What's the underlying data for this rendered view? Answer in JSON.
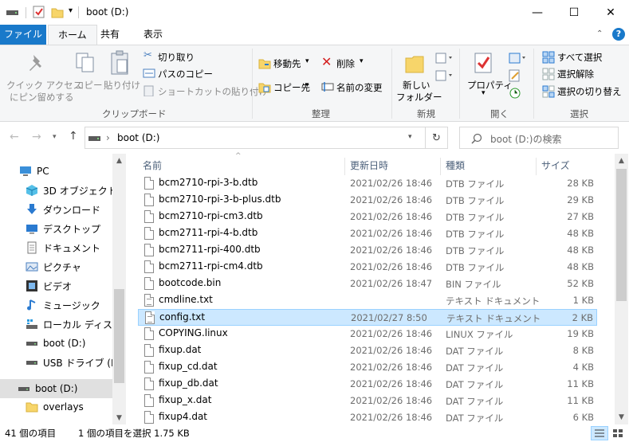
{
  "window": {
    "title": "boot (D:)",
    "minimize": "—",
    "maximize": "☐",
    "close": "✕"
  },
  "ribbon_tabs": {
    "file": "ファイル",
    "home": "ホーム",
    "share": "共有",
    "view": "表示"
  },
  "ribbon": {
    "clipboard": {
      "pin_quick_access": [
        "クイック アクセス",
        "にピン留めする"
      ],
      "copy": "コピー",
      "paste": "貼り付け",
      "cut": "切り取り",
      "copy_path": "パスのコピー",
      "paste_shortcut": "ショートカットの貼り付け",
      "group_label": "クリップボード"
    },
    "organize": {
      "move_to": "移動先",
      "copy_to": "コピー先",
      "delete": "削除",
      "rename": "名前の変更",
      "group_label": "整理"
    },
    "new": {
      "new_folder": [
        "新しい",
        "フォルダー"
      ],
      "group_label": "新規"
    },
    "open": {
      "properties": "プロパティ",
      "group_label": "開く"
    },
    "select": {
      "select_all": "すべて選択",
      "select_none": "選択解除",
      "invert": "選択の切り替え",
      "group_label": "選択"
    }
  },
  "navbar": {
    "path_separator": "›",
    "path_current": "boot (D:)",
    "search_placeholder": "boot (D:)の検索"
  },
  "nav_pane": [
    {
      "label": "PC"
    },
    {
      "label": "3D オブジェクト"
    },
    {
      "label": "ダウンロード"
    },
    {
      "label": "デスクトップ"
    },
    {
      "label": "ドキュメント"
    },
    {
      "label": "ピクチャ"
    },
    {
      "label": "ビデオ"
    },
    {
      "label": "ミュージック"
    },
    {
      "label": "ローカル ディスク (C"
    },
    {
      "label": "boot (D:)"
    },
    {
      "label": "USB ドライブ (E:)"
    },
    {
      "label": "boot (D:)"
    },
    {
      "label": "overlays"
    }
  ],
  "columns": {
    "name": "名前",
    "date": "更新日時",
    "type": "種類",
    "size": "サイズ"
  },
  "files": [
    {
      "name": "bcm2710-rpi-3-b.dtb",
      "date": "2021/02/26 18:46",
      "type": "DTB ファイル",
      "size": "28 KB"
    },
    {
      "name": "bcm2710-rpi-3-b-plus.dtb",
      "date": "2021/02/26 18:46",
      "type": "DTB ファイル",
      "size": "29 KB"
    },
    {
      "name": "bcm2710-rpi-cm3.dtb",
      "date": "2021/02/26 18:46",
      "type": "DTB ファイル",
      "size": "27 KB"
    },
    {
      "name": "bcm2711-rpi-4-b.dtb",
      "date": "2021/02/26 18:46",
      "type": "DTB ファイル",
      "size": "48 KB"
    },
    {
      "name": "bcm2711-rpi-400.dtb",
      "date": "2021/02/26 18:46",
      "type": "DTB ファイル",
      "size": "48 KB"
    },
    {
      "name": "bcm2711-rpi-cm4.dtb",
      "date": "2021/02/26 18:46",
      "type": "DTB ファイル",
      "size": "48 KB"
    },
    {
      "name": "bootcode.bin",
      "date": "2021/02/26 18:47",
      "type": "BIN ファイル",
      "size": "52 KB"
    },
    {
      "name": "cmdline.txt",
      "date": "",
      "type": "テキスト ドキュメント",
      "size": "1 KB"
    },
    {
      "name": "config.txt",
      "date": "2021/02/27 8:50",
      "type": "テキスト ドキュメント",
      "size": "2 KB"
    },
    {
      "name": "COPYING.linux",
      "date": "2021/02/26 18:46",
      "type": "LINUX ファイル",
      "size": "19 KB"
    },
    {
      "name": "fixup.dat",
      "date": "2021/02/26 18:46",
      "type": "DAT ファイル",
      "size": "8 KB"
    },
    {
      "name": "fixup_cd.dat",
      "date": "2021/02/26 18:46",
      "type": "DAT ファイル",
      "size": "4 KB"
    },
    {
      "name": "fixup_db.dat",
      "date": "2021/02/26 18:46",
      "type": "DAT ファイル",
      "size": "11 KB"
    },
    {
      "name": "fixup_x.dat",
      "date": "2021/02/26 18:46",
      "type": "DAT ファイル",
      "size": "11 KB"
    },
    {
      "name": "fixup4.dat",
      "date": "2021/02/26 18:46",
      "type": "DAT ファイル",
      "size": "6 KB"
    }
  ],
  "status": {
    "item_count": "41 個の項目",
    "selected": "1 個の項目を選択  1.75 KB"
  },
  "colors": {
    "accent": "#1979ca",
    "selection": "#cce8ff",
    "selection_border": "#99d1ff"
  }
}
